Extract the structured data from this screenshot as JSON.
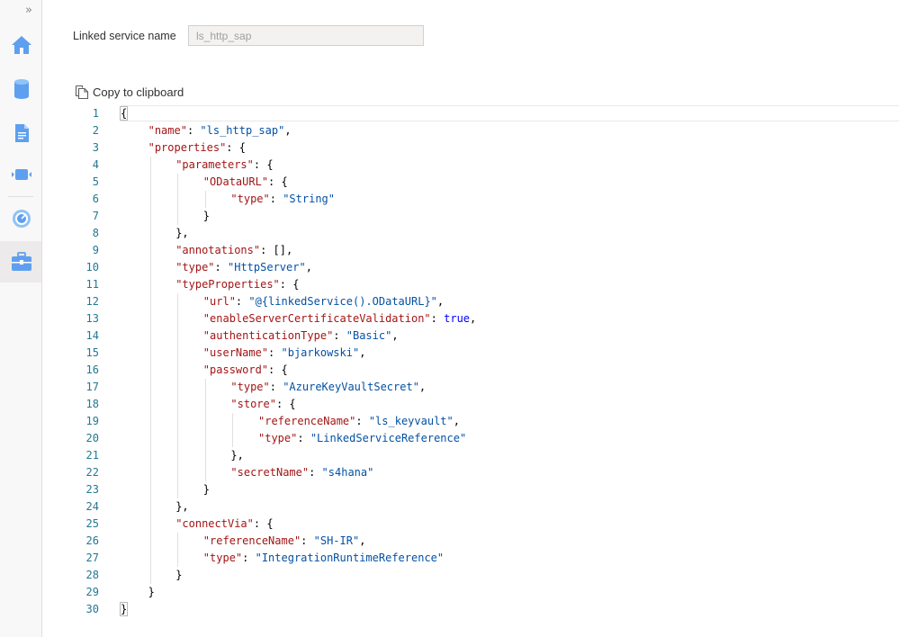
{
  "header": {
    "linked_service_label": "Linked service name",
    "linked_service_value": "ls_http_sap",
    "copy_label": "Copy to clipboard"
  },
  "rail": {
    "expand_glyph": "»",
    "icons": [
      "home-icon",
      "database-icon",
      "document-icon",
      "pipeline-icon",
      "monitor-icon",
      "toolbox-icon"
    ],
    "accent": "#5ea0ef"
  },
  "editor": {
    "lines": [
      {
        "n": "1",
        "ind": 0,
        "parts": [
          [
            "p",
            "{"
          ]
        ]
      },
      {
        "n": "2",
        "ind": 1,
        "parts": [
          [
            "k",
            "\"name\""
          ],
          [
            "p",
            ": "
          ],
          [
            "s",
            "\"ls_http_sap\""
          ],
          [
            "p",
            ","
          ]
        ]
      },
      {
        "n": "3",
        "ind": 1,
        "parts": [
          [
            "k",
            "\"properties\""
          ],
          [
            "p",
            ": {"
          ]
        ]
      },
      {
        "n": "4",
        "ind": 2,
        "parts": [
          [
            "k",
            "\"parameters\""
          ],
          [
            "p",
            ": {"
          ]
        ]
      },
      {
        "n": "5",
        "ind": 3,
        "parts": [
          [
            "k",
            "\"ODataURL\""
          ],
          [
            "p",
            ": {"
          ]
        ]
      },
      {
        "n": "6",
        "ind": 4,
        "parts": [
          [
            "k",
            "\"type\""
          ],
          [
            "p",
            ": "
          ],
          [
            "s",
            "\"String\""
          ]
        ]
      },
      {
        "n": "7",
        "ind": 3,
        "parts": [
          [
            "p",
            "}"
          ]
        ]
      },
      {
        "n": "8",
        "ind": 2,
        "parts": [
          [
            "p",
            "},"
          ]
        ]
      },
      {
        "n": "9",
        "ind": 2,
        "parts": [
          [
            "k",
            "\"annotations\""
          ],
          [
            "p",
            ": [],"
          ]
        ]
      },
      {
        "n": "10",
        "ind": 2,
        "parts": [
          [
            "k",
            "\"type\""
          ],
          [
            "p",
            ": "
          ],
          [
            "s",
            "\"HttpServer\""
          ],
          [
            "p",
            ","
          ]
        ]
      },
      {
        "n": "11",
        "ind": 2,
        "parts": [
          [
            "k",
            "\"typeProperties\""
          ],
          [
            "p",
            ": {"
          ]
        ]
      },
      {
        "n": "12",
        "ind": 3,
        "parts": [
          [
            "k",
            "\"url\""
          ],
          [
            "p",
            ": "
          ],
          [
            "s",
            "\"@{linkedService().ODataURL}\""
          ],
          [
            "p",
            ","
          ]
        ]
      },
      {
        "n": "13",
        "ind": 3,
        "parts": [
          [
            "k",
            "\"enableServerCertificateValidation\""
          ],
          [
            "p",
            ": "
          ],
          [
            "b",
            "true"
          ],
          [
            "p",
            ","
          ]
        ]
      },
      {
        "n": "14",
        "ind": 3,
        "parts": [
          [
            "k",
            "\"authenticationType\""
          ],
          [
            "p",
            ": "
          ],
          [
            "s",
            "\"Basic\""
          ],
          [
            "p",
            ","
          ]
        ]
      },
      {
        "n": "15",
        "ind": 3,
        "parts": [
          [
            "k",
            "\"userName\""
          ],
          [
            "p",
            ": "
          ],
          [
            "s",
            "\"bjarkowski\""
          ],
          [
            "p",
            ","
          ]
        ]
      },
      {
        "n": "16",
        "ind": 3,
        "parts": [
          [
            "k",
            "\"password\""
          ],
          [
            "p",
            ": {"
          ]
        ]
      },
      {
        "n": "17",
        "ind": 4,
        "parts": [
          [
            "k",
            "\"type\""
          ],
          [
            "p",
            ": "
          ],
          [
            "s",
            "\"AzureKeyVaultSecret\""
          ],
          [
            "p",
            ","
          ]
        ]
      },
      {
        "n": "18",
        "ind": 4,
        "parts": [
          [
            "k",
            "\"store\""
          ],
          [
            "p",
            ": {"
          ]
        ]
      },
      {
        "n": "19",
        "ind": 5,
        "parts": [
          [
            "k",
            "\"referenceName\""
          ],
          [
            "p",
            ": "
          ],
          [
            "s",
            "\"ls_keyvault\""
          ],
          [
            "p",
            ","
          ]
        ]
      },
      {
        "n": "20",
        "ind": 5,
        "parts": [
          [
            "k",
            "\"type\""
          ],
          [
            "p",
            ": "
          ],
          [
            "s",
            "\"LinkedServiceReference\""
          ]
        ]
      },
      {
        "n": "21",
        "ind": 4,
        "parts": [
          [
            "p",
            "},"
          ]
        ]
      },
      {
        "n": "22",
        "ind": 4,
        "parts": [
          [
            "k",
            "\"secretName\""
          ],
          [
            "p",
            ": "
          ],
          [
            "s",
            "\"s4hana\""
          ]
        ]
      },
      {
        "n": "23",
        "ind": 3,
        "parts": [
          [
            "p",
            "}"
          ]
        ]
      },
      {
        "n": "24",
        "ind": 2,
        "parts": [
          [
            "p",
            "},"
          ]
        ]
      },
      {
        "n": "25",
        "ind": 2,
        "parts": [
          [
            "k",
            "\"connectVia\""
          ],
          [
            "p",
            ": {"
          ]
        ]
      },
      {
        "n": "26",
        "ind": 3,
        "parts": [
          [
            "k",
            "\"referenceName\""
          ],
          [
            "p",
            ": "
          ],
          [
            "s",
            "\"SH-IR\""
          ],
          [
            "p",
            ","
          ]
        ]
      },
      {
        "n": "27",
        "ind": 3,
        "parts": [
          [
            "k",
            "\"type\""
          ],
          [
            "p",
            ": "
          ],
          [
            "s",
            "\"IntegrationRuntimeReference\""
          ]
        ]
      },
      {
        "n": "28",
        "ind": 2,
        "parts": [
          [
            "p",
            "}"
          ]
        ]
      },
      {
        "n": "29",
        "ind": 1,
        "parts": [
          [
            "p",
            "}"
          ]
        ]
      },
      {
        "n": "30",
        "ind": 0,
        "parts": [
          [
            "p",
            "}"
          ]
        ]
      }
    ]
  }
}
